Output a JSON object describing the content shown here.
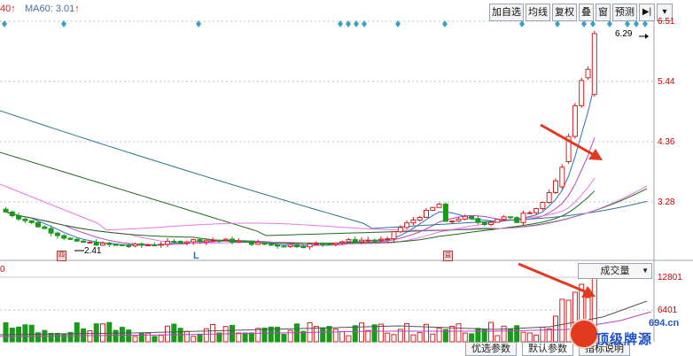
{
  "top_bar": {
    "ma_items": [
      {
        "label": "40",
        "arrow": "↑"
      },
      {
        "label": "MA60: 3.01",
        "arrow": "↑"
      }
    ],
    "toolbar": [
      "加自选",
      "均线",
      "复权",
      "叠",
      "窗",
      "预测"
    ],
    "toolbar_icons": [
      "skip-forward-icon",
      "dropdown-icon"
    ]
  },
  "price_axis": [
    "6.51",
    "5.44",
    "4.36",
    "3.28"
  ],
  "volume_axis": [
    "12801",
    "6401"
  ],
  "annotations": {
    "high_price": "6.29",
    "low_price": "2.41",
    "l_marker": "L",
    "left_tag": "0"
  },
  "volume_panel": {
    "indicator_select": "成交量"
  },
  "bottom_tabs": [
    "优选参数",
    "默认参数",
    "指标说明"
  ],
  "watermark": {
    "line1": "694.cn",
    "line2": "顶级牌源"
  },
  "colors": {
    "up": "#d42020",
    "down": "#1a9a1a",
    "ma5": "#2d6dc0",
    "ma10": "#c040c0",
    "ma20": "#e878e8",
    "ma30": "#1d6a1d",
    "ma60": "#2d7590",
    "arrow": "#e23a1f"
  }
}
